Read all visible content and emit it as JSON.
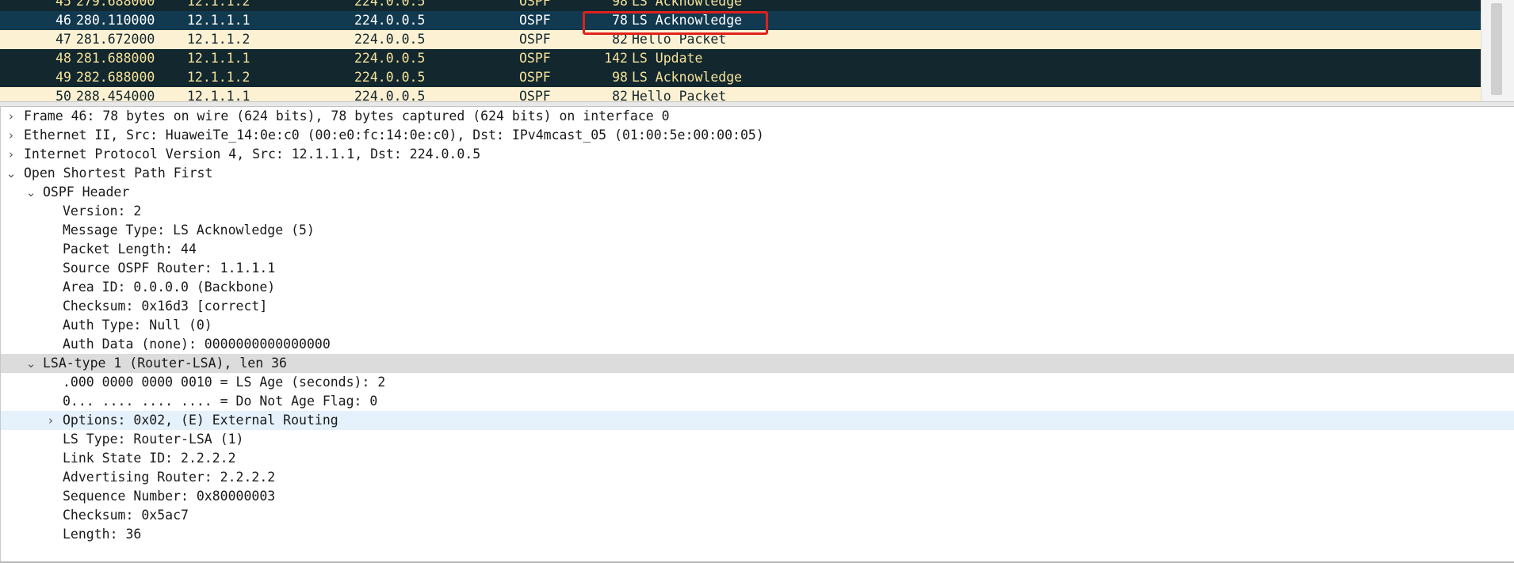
{
  "packet_list": {
    "rows": [
      {
        "no": "45",
        "time": "279.688000",
        "source": "12.1.1.2",
        "destination": "224.0.0.5",
        "protocol": "OSPF",
        "length": "98",
        "info": "LS Acknowledge",
        "style": "dark"
      },
      {
        "no": "46",
        "time": "280.110000",
        "source": "12.1.1.1",
        "destination": "224.0.0.5",
        "protocol": "OSPF",
        "length": "78",
        "info": "LS Acknowledge",
        "style": "sel"
      },
      {
        "no": "47",
        "time": "281.672000",
        "source": "12.1.1.2",
        "destination": "224.0.0.5",
        "protocol": "OSPF",
        "length": "82",
        "info": "Hello Packet",
        "style": "light"
      },
      {
        "no": "48",
        "time": "281.688000",
        "source": "12.1.1.1",
        "destination": "224.0.0.5",
        "protocol": "OSPF",
        "length": "142",
        "info": "LS Update",
        "style": "dark"
      },
      {
        "no": "49",
        "time": "282.688000",
        "source": "12.1.1.2",
        "destination": "224.0.0.5",
        "protocol": "OSPF",
        "length": "98",
        "info": "LS Acknowledge",
        "style": "dark"
      },
      {
        "no": "50",
        "time": "288.454000",
        "source": "12.1.1.1",
        "destination": "224.0.0.5",
        "protocol": "OSPF",
        "length": "82",
        "info": "Hello Packet",
        "style": "light"
      }
    ]
  },
  "details": {
    "frame": "Frame 46: 78 bytes on wire (624 bits), 78 bytes captured (624 bits) on interface 0",
    "ethernet": "Ethernet II, Src: HuaweiTe_14:0e:c0 (00:e0:fc:14:0e:c0), Dst: IPv4mcast_05 (01:00:5e:00:00:05)",
    "ip": "Internet Protocol Version 4, Src: 12.1.1.1, Dst: 224.0.0.5",
    "ospf": "Open Shortest Path First",
    "ospf_header": "OSPF Header",
    "version": "Version: 2",
    "message_type": "Message Type: LS Acknowledge (5)",
    "packet_length": "Packet Length: 44",
    "source_router": "Source OSPF Router: 1.1.1.1",
    "area_id": "Area ID: 0.0.0.0 (Backbone)",
    "checksum": "Checksum: 0x16d3 [correct]",
    "auth_type": "Auth Type: Null (0)",
    "auth_data": "Auth Data (none): 0000000000000000",
    "lsa": "LSA-type 1 (Router-LSA), len 36",
    "ls_age": ".000 0000 0000 0010 = LS Age (seconds): 2",
    "dna_flag": "0... .... .... .... = Do Not Age Flag: 0",
    "options": "Options: 0x02, (E) External Routing",
    "ls_type": "LS Type: Router-LSA (1)",
    "link_state_id": "Link State ID: 2.2.2.2",
    "adv_router": "Advertising Router: 2.2.2.2",
    "seq_number": "Sequence Number: 0x80000003",
    "lsa_checksum": "Checksum: 0x5ac7",
    "lsa_length": "Length: 36"
  }
}
